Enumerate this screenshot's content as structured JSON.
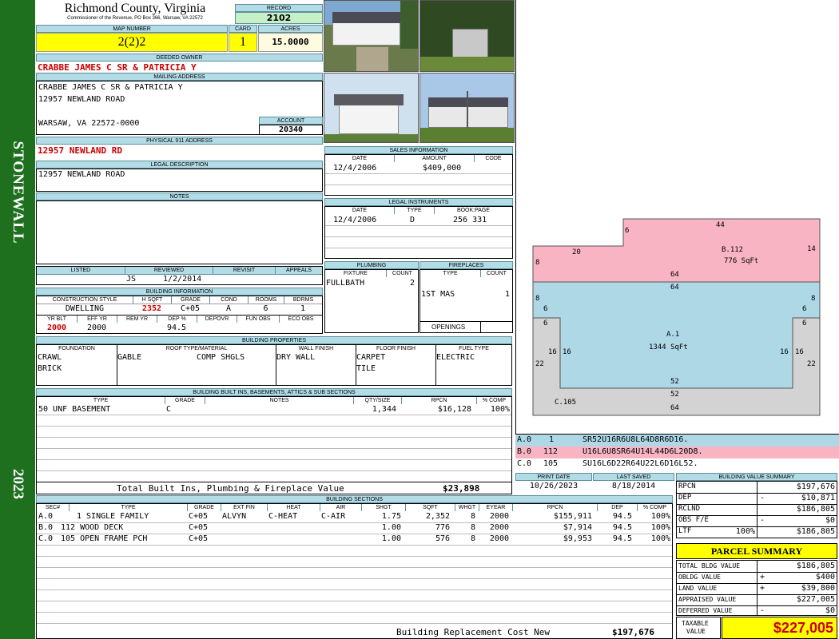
{
  "sidebar": {
    "district": "STONEWALL",
    "year": "2023"
  },
  "header": {
    "county": "Richmond County, Virginia",
    "commissioner": "Commissioner of the Revenue, PO Box 366, Warsaw, VA 22572",
    "record_label": "RECORD",
    "record": "2102",
    "map_label": "MAP NUMBER",
    "map": "2(2)2",
    "card_label": "CARD",
    "card": "1",
    "acres_label": "ACRES",
    "acres": "15.0000"
  },
  "owner": {
    "deeded_label": "DEEDED OWNER",
    "deeded": "CRABBE JAMES C SR & PATRICIA Y",
    "mailing_label": "MAILING ADDRESS",
    "mail1": "CRABBE JAMES C SR & PATRICIA Y",
    "mail2": "12957 NEWLAND ROAD",
    "mail3": "WARSAW, VA 22572-0000",
    "account_label": "ACCOUNT",
    "account": "20340",
    "phys_label": "PHYSICAL 911 ADDRESS",
    "phys": "12957 NEWLAND RD",
    "legal_label": "LEGAL DESCRIPTION",
    "legal": "12957 NEWLAND ROAD",
    "notes_label": "NOTES"
  },
  "listing": {
    "headers": [
      "LISTED",
      "REVIEWED",
      "REVISIT",
      "APPEALS"
    ],
    "reviewer": "JS",
    "reviewed_date": "1/2/2014"
  },
  "building_info": {
    "label": "BUILDING INFORMATION",
    "h1": [
      "CONSTRUCTION STYLE",
      "H SQFT",
      "GRADE",
      "COND",
      "ROOMS",
      "BDRMS"
    ],
    "v1": [
      "DWELLING",
      "2352",
      "C+05",
      "A",
      "6",
      "1"
    ],
    "h2": [
      "YR BLT",
      "EFF YR",
      "REM YR",
      "DEP %",
      "DEPOVR",
      "FUN OBS",
      "ECO OBS"
    ],
    "v2": [
      "2000",
      "2000",
      "",
      "94.5",
      "",
      "",
      ""
    ]
  },
  "props": {
    "label": "BUILDING PROPERTIES",
    "headers": [
      "FOUNDATION",
      "ROOF TYPE/MATERIAL",
      "WALL FINISH",
      "FLOOR FINISH",
      "FUEL TYPE"
    ],
    "foundation": [
      "CRAWL",
      "BRICK"
    ],
    "roof_type": "GABLE",
    "roof_mat": "COMP SHGLS",
    "wall": "DRY WALL",
    "floor": [
      "CARPET",
      "TILE"
    ],
    "fuel": "ELECTRIC"
  },
  "builtins": {
    "label": "BUILDING BUILT INS, BASEMENTS, ATTICS & SUB SECTIONS",
    "headers": [
      "TYPE",
      "GRADE",
      "NOTES",
      "QTY/SIZE",
      "RPCN",
      "% COMP"
    ],
    "rows": [
      {
        "type": "50 UNF BASEMENT",
        "grade": "C",
        "notes": "",
        "qty": "1,344",
        "rpcn": "$16,128",
        "comp": "100%"
      }
    ],
    "total_label": "Total Built Ins, Plumbing & Fireplace Value",
    "total": "$23,898"
  },
  "sales": {
    "label": "SALES INFORMATION",
    "headers": [
      "DATE",
      "AMOUNT",
      "CODE"
    ],
    "rows": [
      {
        "date": "12/4/2006",
        "amount": "$409,000",
        "code": ""
      }
    ]
  },
  "legal_inst": {
    "label": "LEGAL INSTRUMENTS",
    "headers": [
      "DATE",
      "TYPE",
      "BOOK:PAGE"
    ],
    "rows": [
      {
        "date": "12/4/2006",
        "type": "D",
        "book": "256 331"
      }
    ]
  },
  "plumbing": {
    "label": "PLUMBING",
    "headers": [
      "FIXTURE",
      "COUNT"
    ],
    "fixture": "FULLBATH",
    "count": "2"
  },
  "fireplaces": {
    "label": "FIREPLACES",
    "headers": [
      "TYPE",
      "COUNT"
    ],
    "type": "1ST MAS",
    "count": "1",
    "openings_label": "OPENINGS"
  },
  "sketch": {
    "a_label": "A.1",
    "a_area": "1344 SqFt",
    "b_label": "B.112",
    "b_area": "776 SqFt",
    "c_label": "C.105",
    "dims": {
      "b_top": "44",
      "b_step": "6",
      "b_left_top": "20",
      "b_right": "14",
      "b_left": "8",
      "b_bottom": "64",
      "a_top": "64",
      "a_l8": "8",
      "a_r8": "8",
      "a_l6": "6",
      "a_r6": "6",
      "c_l6": "6",
      "c_r6": "6",
      "a_l16": "16",
      "c_l16": "16",
      "a_r16": "16",
      "c_r16": "16",
      "c_l22": "22",
      "c_r22": "22",
      "a_bot52": "52",
      "c_top52": "52",
      "c_bot64": "64"
    },
    "legend": [
      {
        "sec": "A.0",
        "code": "1",
        "trav": "SR52U16R6U8L64D8R6D16."
      },
      {
        "sec": "B.0",
        "code": "112",
        "trav": "U16L6U8SR64U14L44D6L20D8."
      },
      {
        "sec": "C.0",
        "code": "105",
        "trav": "SU16L6D22R64U22L6D16L52."
      }
    ]
  },
  "dates": {
    "print_label": "PRINT DATE",
    "print": "10/26/2023",
    "saved_label": "LAST SAVED",
    "saved": "8/18/2014"
  },
  "sections": {
    "label": "BUILDING SECTIONS",
    "headers": [
      "SEC#",
      "TYPE",
      "GRADE",
      "EXT FIN",
      "HEAT",
      "AIR",
      "SHGT",
      "SQFT",
      "WHGT",
      "EYEAR",
      "RPCN",
      "DEP",
      "% COMP"
    ],
    "rows": [
      {
        "sec": "A.0",
        "type": "1 SINGLE FAMILY",
        "grade": "C+05",
        "ext": "ALVYN",
        "heat": "C-HEAT",
        "air": "C-AIR",
        "shgt": "1.75",
        "sqft": "2,352",
        "whgt": "8",
        "eyear": "2000",
        "rpcn": "$155,911",
        "dep": "94.5",
        "comp": "100%"
      },
      {
        "sec": "B.0",
        "type": "112 WOOD DECK",
        "grade": "C+05",
        "ext": "",
        "heat": "",
        "air": "",
        "shgt": "1.00",
        "sqft": "776",
        "whgt": "8",
        "eyear": "2000",
        "rpcn": "$7,914",
        "dep": "94.5",
        "comp": "100%"
      },
      {
        "sec": "C.0",
        "type": "105 OPEN FRAME PCH",
        "grade": "C+05",
        "ext": "",
        "heat": "",
        "air": "",
        "shgt": "1.00",
        "sqft": "576",
        "whgt": "8",
        "eyear": "2000",
        "rpcn": "$9,953",
        "dep": "94.5",
        "comp": "100%"
      }
    ],
    "total_label": "Building Replacement Cost New",
    "total": "$197,676"
  },
  "bvs": {
    "label": "BUILDING VALUE SUMMARY",
    "rows": [
      {
        "k": "RPCN",
        "s": "",
        "v": "$197,676"
      },
      {
        "k": "DEP",
        "s": "-",
        "v": "$10,871"
      },
      {
        "k": "RCLND",
        "s": "",
        "v": "$186,805"
      },
      {
        "k": "OBS F/E",
        "s": "-",
        "v": "$0"
      },
      {
        "k": "LTF",
        "s": "100%",
        "v": "$186,805"
      }
    ]
  },
  "parcel": {
    "title": "PARCEL SUMMARY",
    "rows": [
      {
        "k": "TOTAL BLDG VALUE",
        "s": "",
        "v": "$186,805"
      },
      {
        "k": "OBLDG VALUE",
        "s": "+",
        "v": "$400"
      },
      {
        "k": "LAND VALUE",
        "s": "+",
        "v": "$39,800"
      },
      {
        "k": "APPRAISED VALUE",
        "s": "",
        "v": "$227,005"
      },
      {
        "k": "DEFERRED VALUE",
        "s": "-",
        "v": "$0"
      }
    ],
    "taxable_label1": "TAXABLE",
    "taxable_label2": "VALUE",
    "taxable": "$227,005"
  },
  "colors": {
    "sidebar": "#1e6f1e",
    "header_blue": "#b3dce6",
    "map_yellow": "#ffff00",
    "record_green": "#c6f0c6",
    "b_pink": "#f9b4c3",
    "a_blue": "#aed8e6",
    "c_gray": "#d3d3d3"
  }
}
